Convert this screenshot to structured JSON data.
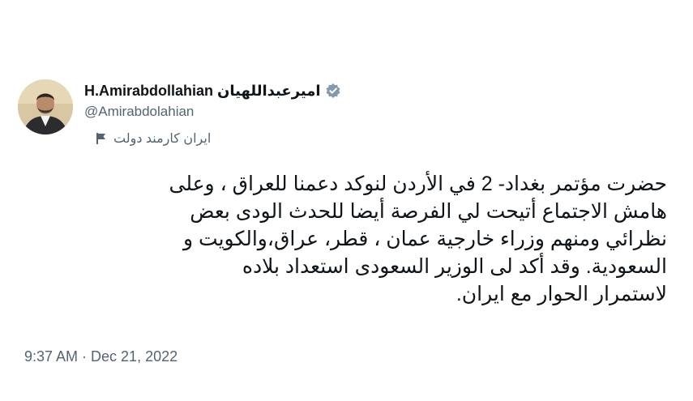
{
  "author": {
    "name": "H.Amirabdollahian امیرعبداللهیان",
    "handle": "@Amirabdolahian",
    "affiliation": "ایران کارمند دولت",
    "verified": true,
    "avatar": "avatar-portrait"
  },
  "tweet": {
    "lines": [
      "حضرت مؤتمر بغداد- 2 في الأردن لنوكد دعمنا للعراق ، وعلى",
      "هامش الاجتماع أتيحت لي الفرصة أيضا للحدث الودى بعض",
      "نظرائي ومنهم وزراء خارجية عمان ، قطر، عراق،والكويت و",
      "السعودية. وقد أكد لى الوزير السعودى استعداد بلاده",
      "لاستمرار الحوار مع ايران."
    ],
    "timestamp": "9:37 AM · Dec 21, 2022"
  },
  "icons": {
    "verified": "verified-badge-icon",
    "affiliation": "flag-icon"
  },
  "colors": {
    "primary_text": "#0f1419",
    "secondary_text": "#536471",
    "badge": "#829aab"
  }
}
